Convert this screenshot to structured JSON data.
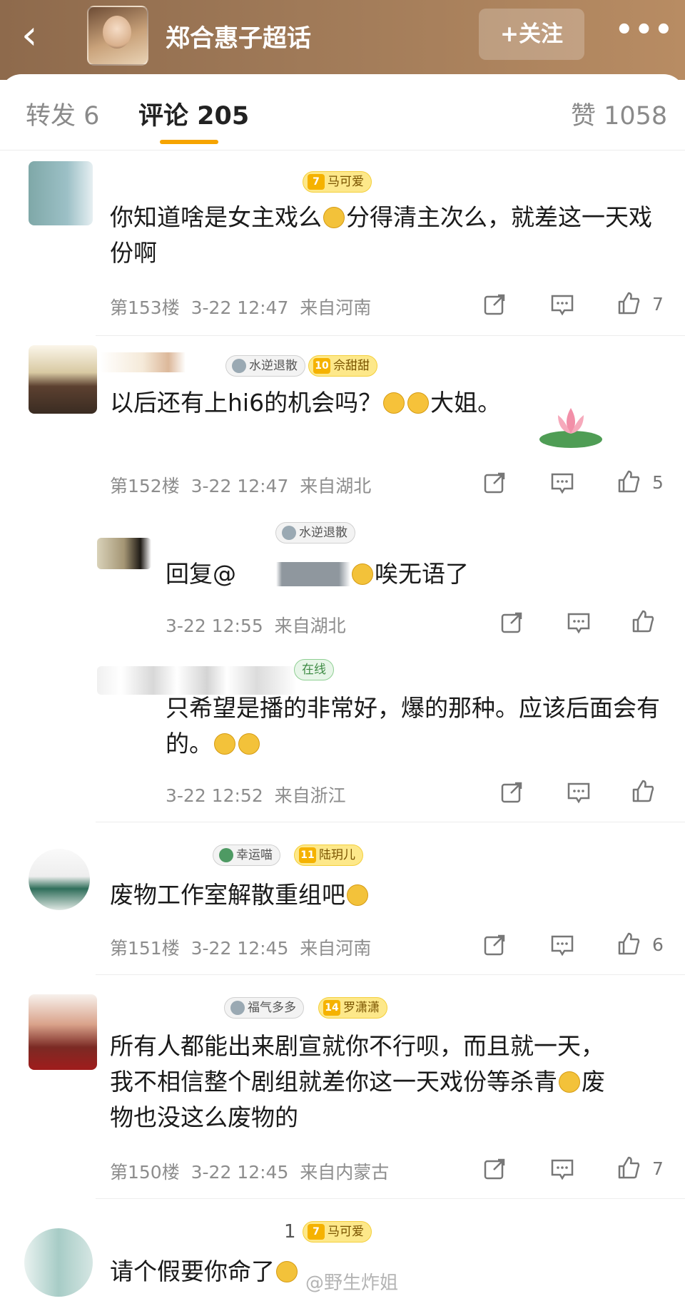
{
  "header": {
    "back_icon": "back-arrow-icon",
    "topic_title": "郑合惠子超话",
    "follow_label": "+关注",
    "more_label": "•••"
  },
  "tabs": {
    "repost": "转发 6",
    "comments": "评论 205",
    "likes": "赞 1058"
  },
  "comments": [
    {
      "badges": [
        {
          "type": "level",
          "level": "7",
          "text": "马可爱"
        }
      ],
      "text_parts": [
        "你知道啥是女主戏么",
        "分得清主次么，就差这一天戏份啊"
      ],
      "floor": "第153楼",
      "time": "3-22 12:47",
      "location": "来自河南",
      "likes": "7"
    },
    {
      "badges": [
        {
          "type": "grey",
          "text": "水逆退散"
        },
        {
          "type": "level",
          "level": "10",
          "text": "佘甜甜"
        }
      ],
      "text_parts": [
        "以后还有上hi6的机会吗？",
        "大姐。"
      ],
      "floor": "第152楼",
      "time": "3-22 12:47",
      "location": "来自湖北",
      "likes": "5",
      "replies": [
        {
          "badges": [
            {
              "type": "grey",
              "text": "水逆退散"
            }
          ],
          "text_parts": [
            "回复@",
            "唉无语了"
          ],
          "time": "3-22 12:55",
          "location": "来自湖北"
        },
        {
          "badges": [
            {
              "type": "green",
              "text": "在线"
            }
          ],
          "text_parts": [
            "只希望是播的非常好，爆的那种。应该后面会有的。"
          ],
          "time": "3-22 12:52",
          "location": "来自浙江"
        }
      ]
    },
    {
      "badges": [
        {
          "type": "grey",
          "text": "幸运喵"
        },
        {
          "type": "level",
          "level": "11",
          "text": "陆玥儿"
        }
      ],
      "text_parts": [
        "废物工作室解散重组吧"
      ],
      "floor": "第151楼",
      "time": "3-22 12:45",
      "location": "来自河南",
      "likes": "6"
    },
    {
      "badges": [
        {
          "type": "grey",
          "text": "福气多多"
        },
        {
          "type": "level",
          "level": "14",
          "text": "罗潇潇"
        }
      ],
      "text_parts": [
        "所有人都能出来剧宣就你不行呗，而且就一天，",
        "我不相信整个剧组就差你这一天戏份等杀青",
        "废",
        "物也没这么废物的"
      ],
      "floor": "第150楼",
      "time": "3-22 12:45",
      "location": "来自内蒙古",
      "likes": "7"
    },
    {
      "badges": [
        {
          "type": "level",
          "level": "7",
          "text": "马可爱"
        }
      ],
      "prefix": "1",
      "text_parts": [
        "请个假要你命了"
      ]
    }
  ],
  "watermark": "@野生炸姐",
  "colors": {
    "header_brown": "#a07a58",
    "tab_underline": "#f6a400",
    "level_badge_bg": "#fde88a"
  }
}
